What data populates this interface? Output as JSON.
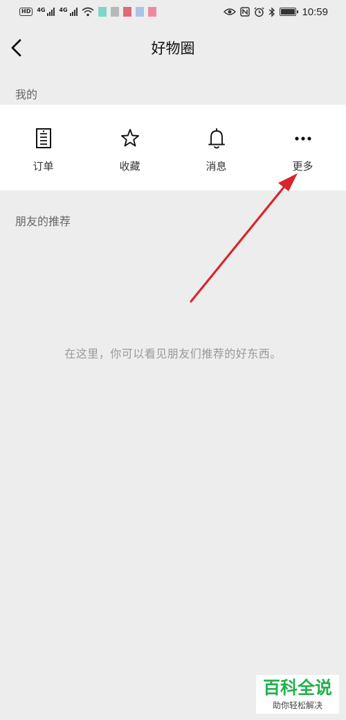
{
  "status_bar": {
    "hd": "HD",
    "network1": "4G",
    "network2": "4G",
    "time": "10:59",
    "icons": [
      "eye-icon",
      "nfc-icon",
      "alarm-icon",
      "bluetooth-icon",
      "battery-icon"
    ]
  },
  "header": {
    "title": "好物圈",
    "back_icon": "chevron-left-icon"
  },
  "my_section": {
    "label": "我的",
    "items": [
      {
        "label": "订单",
        "icon": "order-receipt-icon"
      },
      {
        "label": "收藏",
        "icon": "star-icon"
      },
      {
        "label": "消息",
        "icon": "bell-icon"
      },
      {
        "label": "更多",
        "icon": "more-dots-icon"
      }
    ]
  },
  "friends_section": {
    "label": "朋友的推荐",
    "empty_text": "在这里，你可以看见朋友们推荐的好东西。"
  },
  "annotation": {
    "arrow_color": "#d9252b"
  },
  "watermark": {
    "title": "百科全说",
    "subtitle": "助你轻松解决",
    "color": "#22b14c"
  }
}
